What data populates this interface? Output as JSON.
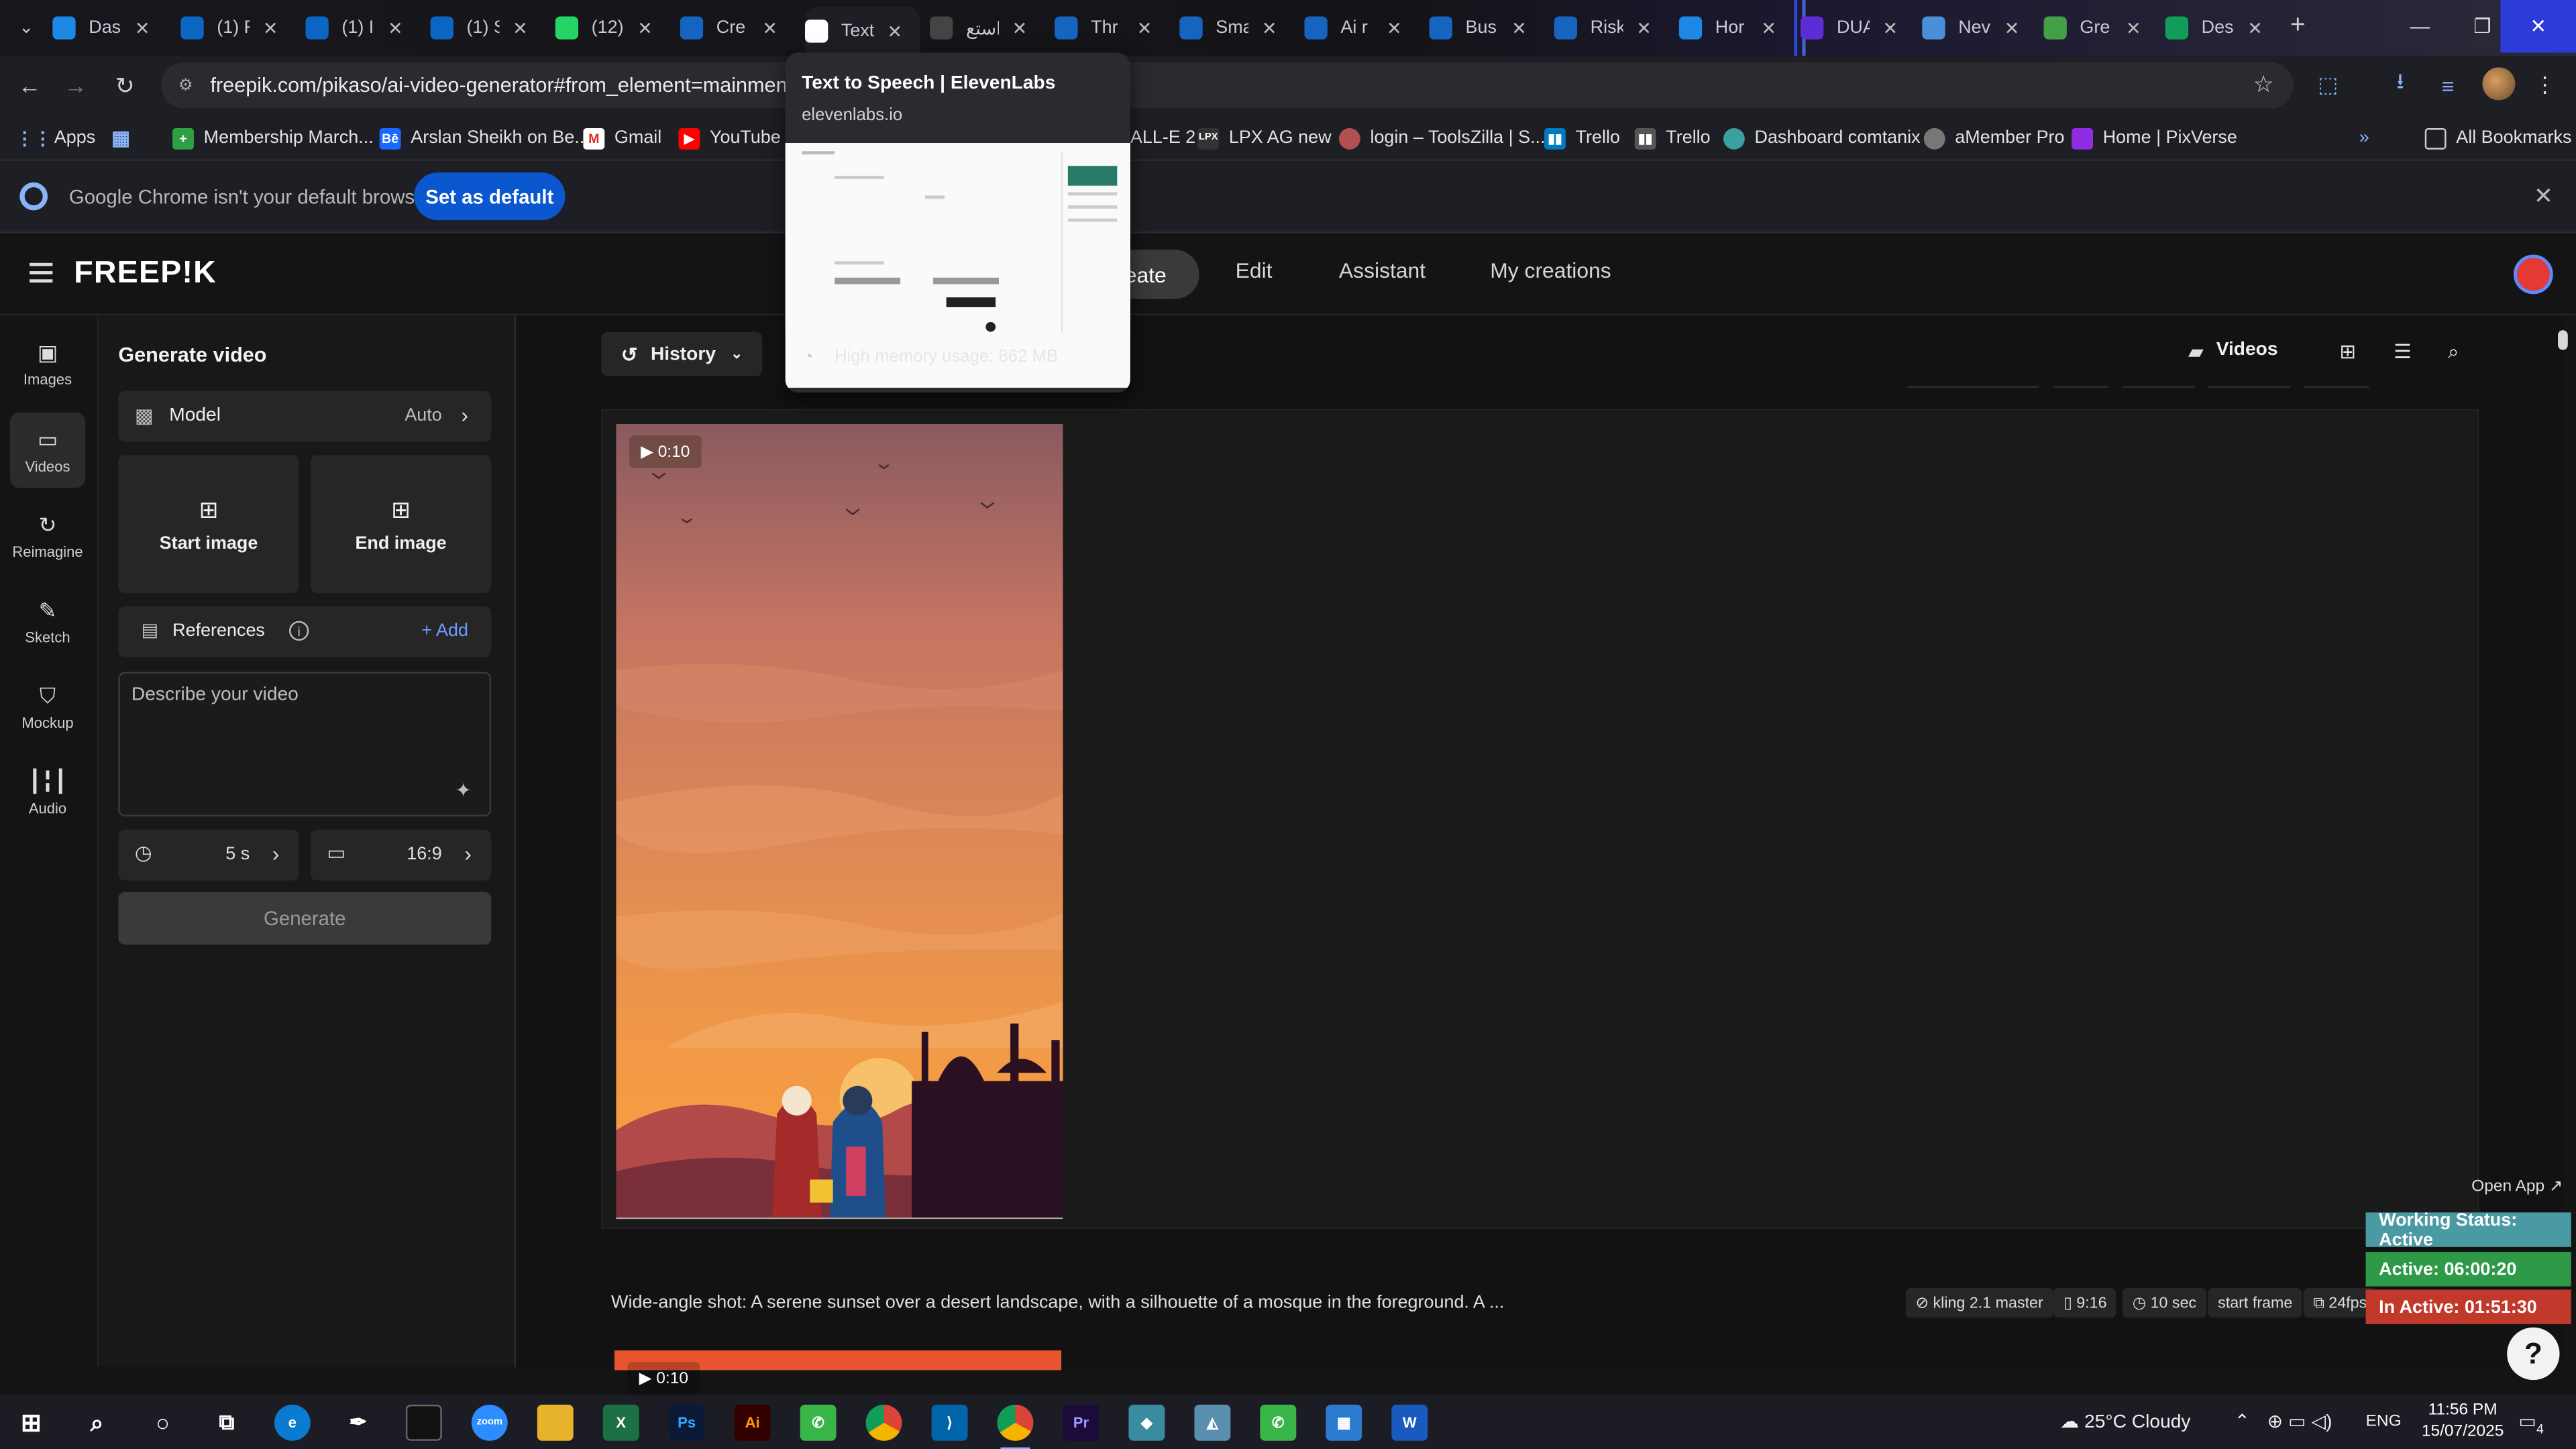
{
  "browser": {
    "tabs": [
      {
        "title": "Das",
        "icon": "generic-app-icon",
        "color": "#1e88e5"
      },
      {
        "title": "(1) F",
        "icon": "linkedin-icon",
        "color": "#0a66c2"
      },
      {
        "title": "(1) I",
        "icon": "linkedin-icon",
        "color": "#0a66c2"
      },
      {
        "title": "(1) S",
        "icon": "linkedin-icon",
        "color": "#0a66c2"
      },
      {
        "title": "(12)",
        "icon": "whatsapp-icon",
        "color": "#25d366"
      },
      {
        "title": "Cre",
        "icon": "freepik-icon",
        "color": "#1565c0"
      },
      {
        "title": "Text",
        "icon": "elevenlabs-icon",
        "color": "#ffffff"
      },
      {
        "title": "استع",
        "icon": "generic-app-icon",
        "color": "#444444"
      },
      {
        "title": "Thr",
        "icon": "freepik-icon",
        "color": "#1565c0"
      },
      {
        "title": "Sma",
        "icon": "freepik-icon",
        "color": "#1565c0"
      },
      {
        "title": "Ai r",
        "icon": "freepik-icon",
        "color": "#1565c0"
      },
      {
        "title": "Bus",
        "icon": "freepik-icon",
        "color": "#1565c0"
      },
      {
        "title": "Risk",
        "icon": "freepik-icon",
        "color": "#1565c0"
      },
      {
        "title": "Hor",
        "icon": "generic-app-icon",
        "color": "#1e88e5"
      },
      {
        "title": "DUA",
        "icon": "video-app-icon",
        "color": "#5c2dd5"
      },
      {
        "title": "Nev",
        "icon": "chrome-icon",
        "color": "#4a90d9"
      },
      {
        "title": "Gre",
        "icon": "palm-icon",
        "color": "#43a047"
      },
      {
        "title": "Des",
        "icon": "sheets-icon",
        "color": "#0f9d58"
      }
    ],
    "url": "freepik.com/pikaso/ai-video-generator#from_element=mainmenu",
    "bookmarks": {
      "apps": "Apps",
      "items": [
        "Membership March...",
        "Arslan Sheikh on Be...",
        "Gmail",
        "YouTube",
        "ALL-E 2",
        "LPX AG new",
        "login – ToolsZilla | S...",
        "Trello",
        "Trello",
        "Dashboard comtanix",
        "aMember Pro",
        "Home | PixVerse"
      ],
      "all": "All Bookmarks"
    },
    "infobar": {
      "message": "Google Chrome isn't your default browser",
      "button": "Set as default"
    },
    "hover_card": {
      "title": "Text to Speech | ElevenLabs",
      "host": "elevenlabs.io",
      "memory": "High memory usage: 862 MB"
    }
  },
  "freepik": {
    "logo": "FREEP!K",
    "nav": {
      "create": "eate",
      "edit": "Edit",
      "assistant": "Assistant",
      "my_creations": "My creations"
    },
    "rail": [
      "Images",
      "Videos",
      "Reimagine",
      "Sketch",
      "Mockup",
      "Audio"
    ],
    "panel": {
      "title": "Generate video",
      "model_label": "Model",
      "model_value": "Auto",
      "start_image": "Start image",
      "end_image": "End image",
      "references": "References",
      "add": "+ Add",
      "prompt_placeholder": "Describe your video",
      "duration": "5 s",
      "aspect": "16:9",
      "generate": "Generate"
    },
    "main": {
      "history": "History",
      "videos": "Videos",
      "duration_badge": "0:10",
      "open_app": "Open App ↗",
      "caption": "Wide-angle shot: A serene sunset over a desert landscape, with a silhouette of a mosque in the foreground. A ...",
      "tags": [
        "kling 2.1 master",
        "9:16",
        "10 sec",
        "start frame",
        "24fps"
      ],
      "second_badge": "0:10"
    }
  },
  "work_status": {
    "status": "Working Status: Active",
    "active": "Active: 06:00:20",
    "inactive": "In Active: 01:51:30",
    "colors": {
      "status": "#4a9aa3",
      "active": "#2e9a48",
      "inactive": "#c0392b"
    }
  },
  "taskbar": {
    "apps": [
      "start",
      "search",
      "cortana",
      "task-view",
      "edge",
      "pen",
      "terminal",
      "zoom",
      "explorer",
      "excel",
      "photoshop",
      "illustrator",
      "phone",
      "chrome",
      "vscode",
      "chrome",
      "premiere",
      "app",
      "app",
      "phone",
      "calculator",
      "word"
    ],
    "weather": "25°C  Cloudy",
    "lang": "ENG",
    "time": "11:56 PM",
    "date": "15/07/2025",
    "notif_count": "4"
  }
}
